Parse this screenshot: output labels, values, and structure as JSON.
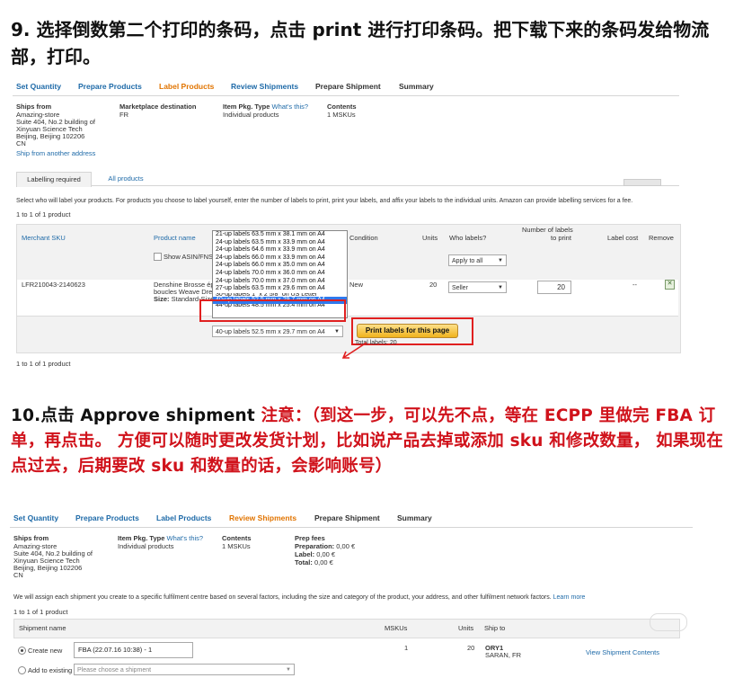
{
  "step9": {
    "text": "9. 选择倒数第二个打印的条码，点击 print 进行打印条码。把下载下来的条码发给物流部，打印。"
  },
  "shot1": {
    "steps": [
      {
        "label": "Set Quantity"
      },
      {
        "label": "Prepare Products"
      },
      {
        "label": "Label Products"
      },
      {
        "label": "Review Shipments"
      },
      {
        "label": "Prepare Shipment"
      },
      {
        "label": "Summary"
      }
    ],
    "ships_from_label": "Ships from",
    "ships_from_lines": [
      "Amazing-store",
      "Suite 404, No.2 building of",
      "Xinyuan Science Tech",
      "Beijing, Beijing 102206",
      "CN"
    ],
    "ship_from_another": "Ship from another address",
    "marketplace_label": "Marketplace destination",
    "marketplace_value": "FR",
    "item_pkg_label": "Item Pkg. Type",
    "whats_this": "What's this?",
    "item_pkg_value": "Individual products",
    "contents_label": "Contents",
    "contents_value": "1 MSKUs",
    "tab_labelling": "Labelling required",
    "tab_all": "All products",
    "instructions": "Select who will label your products. For products you choose to label yourself, enter the number of labels to print, print your labels, and affix your labels to the individual units. Amazon can provide labelling services for a fee.",
    "count_top": "1 to 1 of 1 product",
    "col_msku": "Merchant SKU",
    "col_product": "Product name",
    "col_condition": "Condition",
    "col_units": "Units",
    "col_who": "Who labels?",
    "col_num_labels_1": "Number of labels",
    "col_num_labels_2": "to print",
    "col_label_cost": "Label cost",
    "col_remove": "Remove",
    "show_asin": "Show ASIN/FNS",
    "apply_all": "Apply to all",
    "sku": "LFR210043-2140623",
    "product_line1": "Denshine Brosse ép",
    "product_line2": "boucles Weave Dre",
    "product_line3_label": "Size:",
    "product_line3_value": "Standard-Size",
    "condition": "New",
    "units": "20",
    "who_value": "Seller",
    "num_labels": "20",
    "label_cost": "--",
    "dropdown_options": [
      "21-up labels 63.5 mm x 38.1 mm on A4",
      "24-up labels 63.5 mm x 33.9 mm on A4",
      "24-up labels 64.6 mm x 33.9 mm on A4",
      "24-up labels 66.0 mm x 33.9 mm on A4",
      "24-up labels 66.0 mm x 35.0 mm on A4",
      "24-up labels 70.0 mm x 36.0 mm on A4",
      "24-up labels 70.0 mm x 37.0 mm on A4",
      "27-up labels 63.5 mm x 29.6 mm on A4",
      "30-up labels 1\" x 2 5/8\" on US Letter",
      "40-up labels 52.5 mm x 29.7 mm on A4",
      "44-up labels 48.5 mm x 25.4 mm on A4"
    ],
    "dropdown_selected": "40-up labels 52.5 mm x 29.7 mm on A4",
    "print_button": "Print labels for this page",
    "total_labels": "Total labels: 20",
    "count_bottom": "1 to 1 of 1 product"
  },
  "step10": {
    "prefix": "10.点击 Approve shipment",
    "note": "注意：（到这一步，可以先不点，等在 ECPP 里做完 FBA 订单，再点击。 方便可以随时更改发货计划，比如说产品去掉或添加 sku 和修改数量，  如果现在点过去，后期要改 sku 和数量的话，会影响账号）"
  },
  "shot2": {
    "steps": [
      {
        "label": "Set Quantity"
      },
      {
        "label": "Prepare Products"
      },
      {
        "label": "Label Products"
      },
      {
        "label": "Review Shipments"
      },
      {
        "label": "Prepare Shipment"
      },
      {
        "label": "Summary"
      }
    ],
    "ships_from_label": "Ships from",
    "ships_from_lines": [
      "Amazing-store",
      "Suite 404, No.2 building of",
      "Xinyuan Science Tech",
      "Beijing, Beijing 102206",
      "CN"
    ],
    "item_pkg_label": "Item Pkg. Type",
    "whats_this": "What's this?",
    "item_pkg_value": "Individual products",
    "contents_label": "Contents",
    "contents_value": "1 MSKUs",
    "prep_fees_label": "Prep fees",
    "prep_label": "Preparation:",
    "prep_value": "0,00 €",
    "label_label": "Label:",
    "label_value": "0,00 €",
    "total_label": "Total:",
    "total_value": "0,00 €",
    "assign_text": "We will assign each shipment you create to a specific fulfilment centre based on several factors, including the size and category of the product, your address, and other fulfilment network factors.",
    "learn_more": "Learn more",
    "count": "1 to 1 of 1 product",
    "col_shipment_name": "Shipment name",
    "col_mskus": "MSKUs",
    "col_units": "Units",
    "col_ship_to": "Ship to",
    "create_new": "Create new",
    "shipment_name_value": "FBA (22.07.16 10:38) - 1",
    "mskus_value": "1",
    "units_value": "20",
    "ship_to_code": "ORY1",
    "ship_to_city": "SARAN, FR",
    "view_contents": "View Shipment Contents",
    "add_existing": "Add to existing",
    "choose_shipment": "Please choose a shipment"
  }
}
